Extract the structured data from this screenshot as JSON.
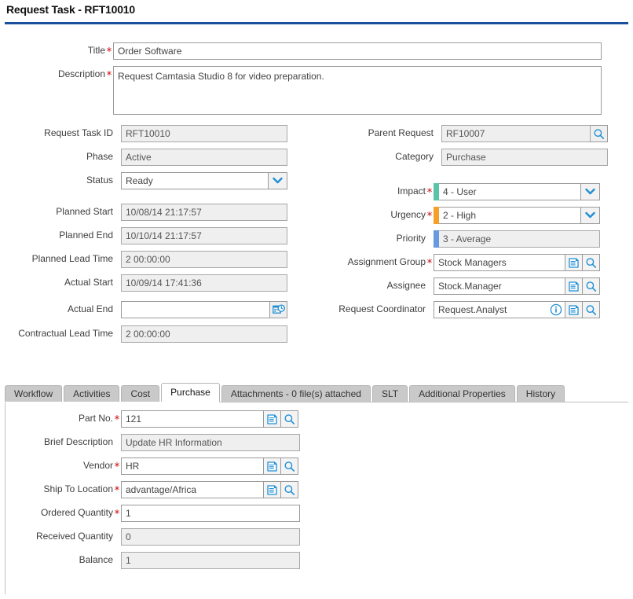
{
  "header": {
    "title": "Request Task - RFT10010",
    "rule_color": "#1a4f9c"
  },
  "colors": {
    "required_star": "#cc0000",
    "impact_accent": "#5bc4a8",
    "urgency_accent": "#f5a02a",
    "priority_accent": "#6699dd",
    "icon_blue": "#1f8fd6",
    "tab_inactive": "#c9c9c9",
    "readonly_bg": "#efefef"
  },
  "main_form": {
    "title": {
      "label": "Title",
      "value": "Order Software",
      "required": true
    },
    "description": {
      "label": "Description",
      "value": "Request Camtasia Studio 8 for video preparation.",
      "required": true
    },
    "left_column": [
      {
        "label": "Request Task ID",
        "value": "RFT10010",
        "required": false,
        "readonly": true,
        "control": "text"
      },
      {
        "label": "Phase",
        "value": "Active",
        "required": false,
        "readonly": true,
        "control": "text"
      },
      {
        "label": "Status",
        "value": "Ready",
        "required": false,
        "readonly": false,
        "control": "select"
      },
      {
        "label": "Planned Start",
        "value": "10/08/14 21:17:57",
        "required": false,
        "readonly": true,
        "control": "text"
      },
      {
        "label": "Planned End",
        "value": "10/10/14 21:17:57",
        "required": false,
        "readonly": true,
        "control": "text"
      },
      {
        "label": "Planned Lead Time",
        "value": "2 00:00:00",
        "required": false,
        "readonly": true,
        "control": "text"
      },
      {
        "label": "Actual Start",
        "value": "10/09/14 17:41:36",
        "required": false,
        "readonly": true,
        "control": "text"
      },
      {
        "label": "Actual End",
        "value": "",
        "required": false,
        "readonly": false,
        "control": "datetime"
      },
      {
        "label": "Contractual Lead Time",
        "value": "2 00:00:00",
        "required": false,
        "readonly": true,
        "control": "text"
      }
    ],
    "right_column": [
      {
        "label": "Parent Request",
        "value": "RF10007",
        "required": false,
        "readonly": true,
        "control": "lookup"
      },
      {
        "label": "Category",
        "value": "Purchase",
        "required": false,
        "readonly": true,
        "control": "text"
      },
      {
        "label": "Impact",
        "value": "4 - User",
        "required": true,
        "readonly": false,
        "control": "select",
        "accent": "#5bc4a8"
      },
      {
        "label": "Urgency",
        "value": "2 - High",
        "required": true,
        "readonly": false,
        "control": "select",
        "accent": "#f5a02a"
      },
      {
        "label": "Priority",
        "value": "3 - Average",
        "required": false,
        "readonly": true,
        "control": "text",
        "accent": "#6699dd"
      },
      {
        "label": "Assignment Group",
        "value": "Stock Managers",
        "required": true,
        "readonly": false,
        "control": "picker"
      },
      {
        "label": "Assignee",
        "value": "Stock.Manager",
        "required": false,
        "readonly": false,
        "control": "picker"
      },
      {
        "label": "Request Coordinator",
        "value": "Request.Analyst",
        "required": false,
        "readonly": false,
        "control": "picker-info"
      }
    ]
  },
  "tabs": [
    {
      "label": "Workflow",
      "active": false
    },
    {
      "label": "Activities",
      "active": false
    },
    {
      "label": "Cost",
      "active": false
    },
    {
      "label": "Purchase",
      "active": true
    },
    {
      "label": "Attachments  -  0 file(s) attached",
      "active": false
    },
    {
      "label": "SLT",
      "active": false
    },
    {
      "label": "Additional Properties",
      "active": false
    },
    {
      "label": "History",
      "active": false
    }
  ],
  "purchase_tab": {
    "fields": [
      {
        "label": "Part No.",
        "value": "121",
        "required": true,
        "readonly": false,
        "control": "picker"
      },
      {
        "label": "Brief Description",
        "value": "Update HR Information",
        "required": false,
        "readonly": true,
        "control": "text"
      },
      {
        "label": "Vendor",
        "value": "HR",
        "required": true,
        "readonly": false,
        "control": "picker"
      },
      {
        "label": "Ship To Location",
        "value": "advantage/Africa",
        "required": true,
        "readonly": false,
        "control": "picker"
      },
      {
        "label": "Ordered Quantity",
        "value": "1",
        "required": true,
        "readonly": false,
        "control": "text"
      },
      {
        "label": "Received Quantity",
        "value": "0",
        "required": false,
        "readonly": true,
        "control": "text"
      },
      {
        "label": "Balance",
        "value": "1",
        "required": false,
        "readonly": true,
        "control": "text"
      }
    ]
  },
  "icons": {
    "lookup": "magnifier-icon",
    "picker": "record-list-icon",
    "info": "info-circle-icon",
    "datetime": "calendar-clock-icon",
    "dropdown": "chevron-down-icon"
  }
}
